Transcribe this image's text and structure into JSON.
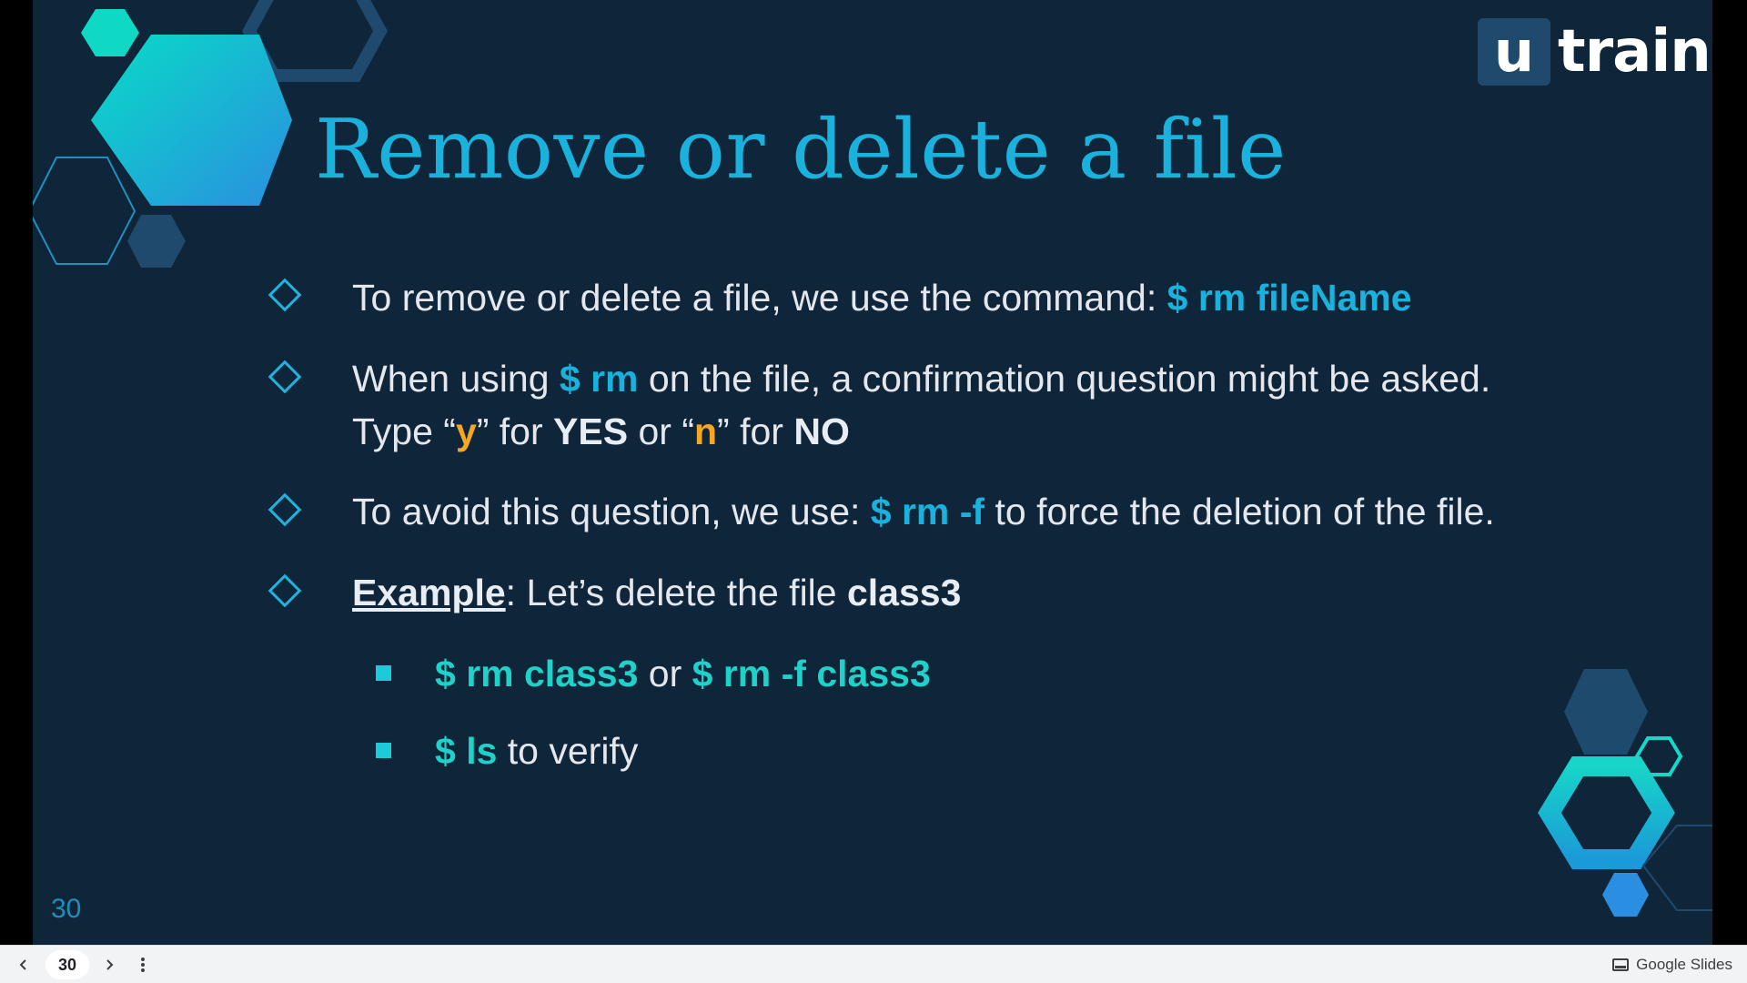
{
  "logo": {
    "u": "u",
    "train": "train"
  },
  "title": "Remove or delete a file",
  "bullets": [
    {
      "pre": "To remove or delete a file, we use the command: ",
      "cmd": "$ rm fileName"
    },
    {
      "pre": "When using ",
      "cmd": "$ rm",
      "post": " on the file, a confirmation question might be asked.",
      "line2_pre": "Type “",
      "y": "y",
      "mid1": "” for ",
      "yes": "YES",
      "mid2": " or “",
      "n": "n",
      "mid3": "” for ",
      "no": "NO"
    },
    {
      "pre": "To avoid this question, we use: ",
      "cmd": "$ rm -f",
      "post": " to force the deletion of the file."
    },
    {
      "label": "Example",
      "pre": ": Let’s delete the file ",
      "file": "class3"
    }
  ],
  "sub_bullets": [
    {
      "cmd1": "$ rm class3",
      "mid": " or ",
      "cmd2": "$ rm -f class3"
    },
    {
      "cmd": "$ ls",
      "post": " to verify"
    }
  ],
  "slide_number": "30",
  "toolbar": {
    "page": "30",
    "app_name": "Google Slides"
  },
  "icons": [
    "prev-arrow-icon",
    "next-arrow-icon",
    "more-vert-icon",
    "google-slides-icon"
  ],
  "colors": {
    "background": "#0f2539",
    "accent": "#1bb1dd",
    "accent_green": "#1fd1c8",
    "highlight": "#f5a623"
  }
}
